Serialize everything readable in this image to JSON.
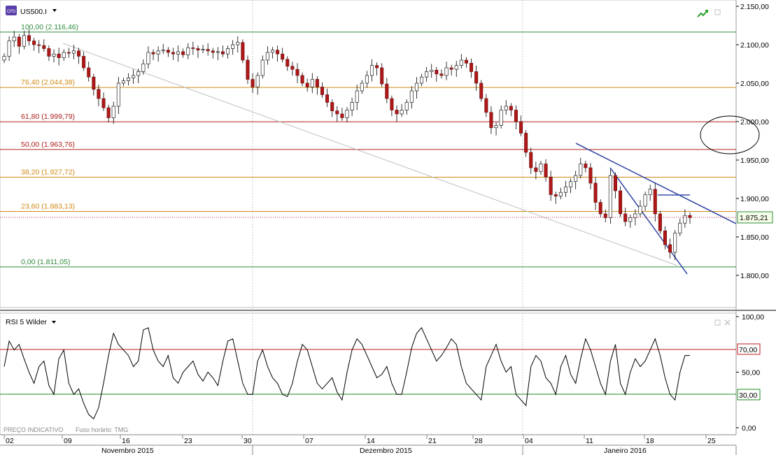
{
  "instrument": {
    "symbol": "US500.I",
    "badge": "CFD",
    "dropdown_icon": "caret-down-icon"
  },
  "toolbar_icons": [
    "trend-arrow-icon",
    "maximize-icon"
  ],
  "current_price": "1.875,21",
  "fibonacci": [
    {
      "pct": "100,00",
      "price": "2.116,46",
      "value": 2116.46,
      "color": "#2e8b3a"
    },
    {
      "pct": "76,40",
      "price": "2.044,38",
      "value": 2044.38,
      "color": "#d08a14"
    },
    {
      "pct": "61,80",
      "price": "1.999,79",
      "value": 1999.79,
      "color": "#b02020"
    },
    {
      "pct": "50,00",
      "price": "1.963,76",
      "value": 1963.76,
      "color": "#b02020"
    },
    {
      "pct": "38,20",
      "price": "1.927,72",
      "value": 1927.72,
      "color": "#d08a14"
    },
    {
      "pct": "23,60",
      "price": "1.883,13",
      "value": 1883.13,
      "color": "#d08a14"
    },
    {
      "pct": "0,00",
      "price": "1.811,05",
      "value": 1811.05,
      "color": "#2e8b3a"
    }
  ],
  "price_axis_ticks": [
    "2.150,00",
    "2.100,00",
    "2.050,00",
    "2.000,00",
    "1.950,00",
    "1.900,00",
    "1.850,00",
    "1.800,00"
  ],
  "rsi": {
    "label": "RSI 5 Wilder",
    "overbought": "70,00",
    "oversold": "30,00",
    "axis_ticks": [
      "100,00",
      "70,00",
      "50,00",
      "30,00",
      "0,00"
    ]
  },
  "footer": {
    "preco": "PREÇO INDICATIVO",
    "tz": "Fuso horário: TMG"
  },
  "date_ticks": [
    "02",
    "09",
    "16",
    "23",
    "30",
    "07",
    "14",
    "21",
    "28",
    "04",
    "11",
    "18",
    "25"
  ],
  "months": [
    "Novembro 2015",
    "Dezembro 2015",
    "Janeiro 2016"
  ],
  "chart_data": {
    "type": "candlestick",
    "title": "US500.I",
    "ylim": [
      1760,
      2150
    ],
    "x_daily_closes": [
      2085,
      2105,
      2110,
      2098,
      2112,
      2105,
      2100,
      2099,
      2095,
      2085,
      2088,
      2083,
      2090,
      2089,
      2092,
      2085,
      2070,
      2058,
      2042,
      2030,
      2018,
      2005,
      2020,
      2050,
      2053,
      2057,
      2060,
      2065,
      2075,
      2090,
      2088,
      2092,
      2093,
      2090,
      2088,
      2091,
      2087,
      2096,
      2095,
      2093,
      2094,
      2092,
      2090,
      2091,
      2088,
      2095,
      2100,
      2103,
      2080,
      2055,
      2045,
      2060,
      2080,
      2090,
      2093,
      2088,
      2081,
      2072,
      2068,
      2060,
      2050,
      2045,
      2055,
      2045,
      2035,
      2025,
      2014,
      2010,
      2005,
      2015,
      2025,
      2040,
      2050,
      2060,
      2073,
      2070,
      2049,
      2030,
      2015,
      2010,
      2015,
      2025,
      2040,
      2050,
      2058,
      2065,
      2067,
      2062,
      2060,
      2070,
      2068,
      2073,
      2080,
      2076,
      2065,
      2050,
      2030,
      2012,
      1992,
      1995,
      2015,
      2020,
      2015,
      2000,
      1985,
      1960,
      1940,
      1935,
      1945,
      1928,
      1905,
      1903,
      1908,
      1915,
      1922,
      1930,
      1945,
      1940,
      1920,
      1895,
      1880,
      1875,
      1930,
      1910,
      1880,
      1870,
      1875,
      1880,
      1890,
      1905,
      1912,
      1880,
      1858,
      1840,
      1830,
      1855,
      1868,
      1878,
      1875
    ],
    "rsi_values": [
      55,
      78,
      70,
      75,
      62,
      50,
      40,
      55,
      60,
      38,
      30,
      62,
      70,
      40,
      30,
      35,
      22,
      12,
      8,
      18,
      40,
      65,
      85,
      75,
      70,
      65,
      55,
      60,
      88,
      90,
      70,
      60,
      55,
      65,
      45,
      40,
      50,
      55,
      60,
      48,
      42,
      50,
      45,
      38,
      60,
      78,
      80,
      60,
      40,
      30,
      30,
      60,
      70,
      55,
      45,
      40,
      30,
      28,
      40,
      60,
      75,
      70,
      55,
      40,
      35,
      40,
      45,
      32,
      25,
      50,
      70,
      80,
      75,
      65,
      55,
      45,
      48,
      55,
      40,
      30,
      30,
      50,
      72,
      85,
      90,
      80,
      70,
      60,
      65,
      72,
      80,
      75,
      55,
      40,
      35,
      30,
      25,
      55,
      65,
      75,
      60,
      50,
      55,
      30,
      25,
      20,
      55,
      65,
      60,
      45,
      40,
      30,
      55,
      65,
      48,
      40,
      62,
      80,
      70,
      55,
      40,
      30,
      60,
      75,
      40,
      30,
      50,
      62,
      55,
      60,
      70,
      80,
      65,
      45,
      30,
      25,
      50,
      65,
      65
    ],
    "overbought": 70,
    "oversold": 30
  }
}
